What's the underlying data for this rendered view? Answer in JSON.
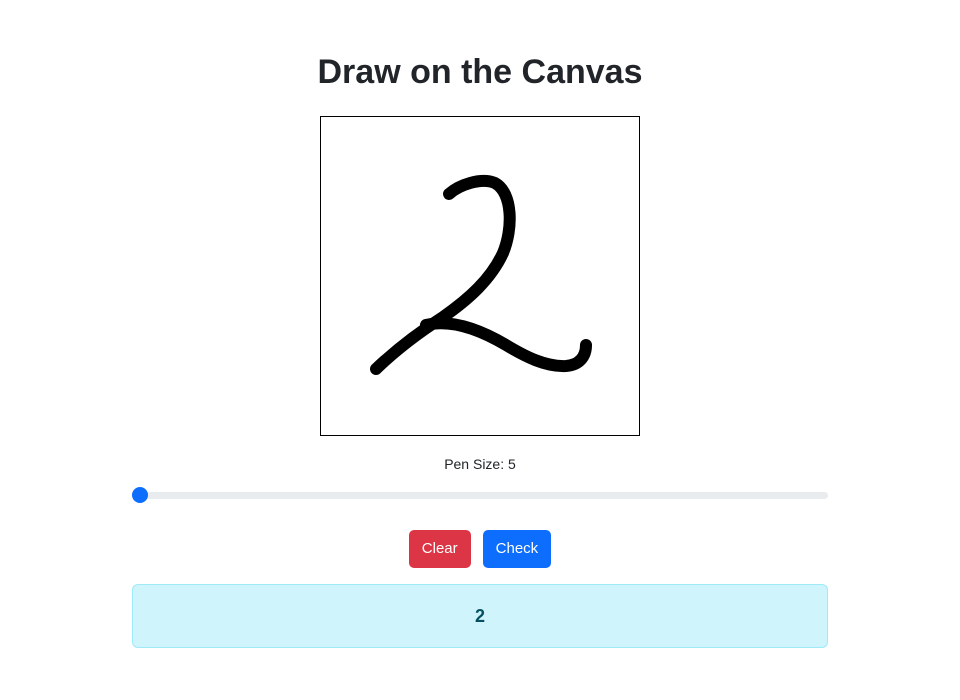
{
  "page": {
    "title": "Draw on the Canvas"
  },
  "canvas": {
    "drawing": "handwritten-digit-2",
    "stroke_color": "#000000"
  },
  "pen": {
    "label": "Pen Size: 5",
    "size": 5,
    "slider_fraction": 0.0
  },
  "buttons": {
    "clear_label": "Clear",
    "check_label": "Check"
  },
  "result": {
    "text": "2"
  },
  "colors": {
    "danger": "#dc3545",
    "primary": "#0d6efd",
    "info_bg": "#cff4fc",
    "info_text": "#055160"
  }
}
